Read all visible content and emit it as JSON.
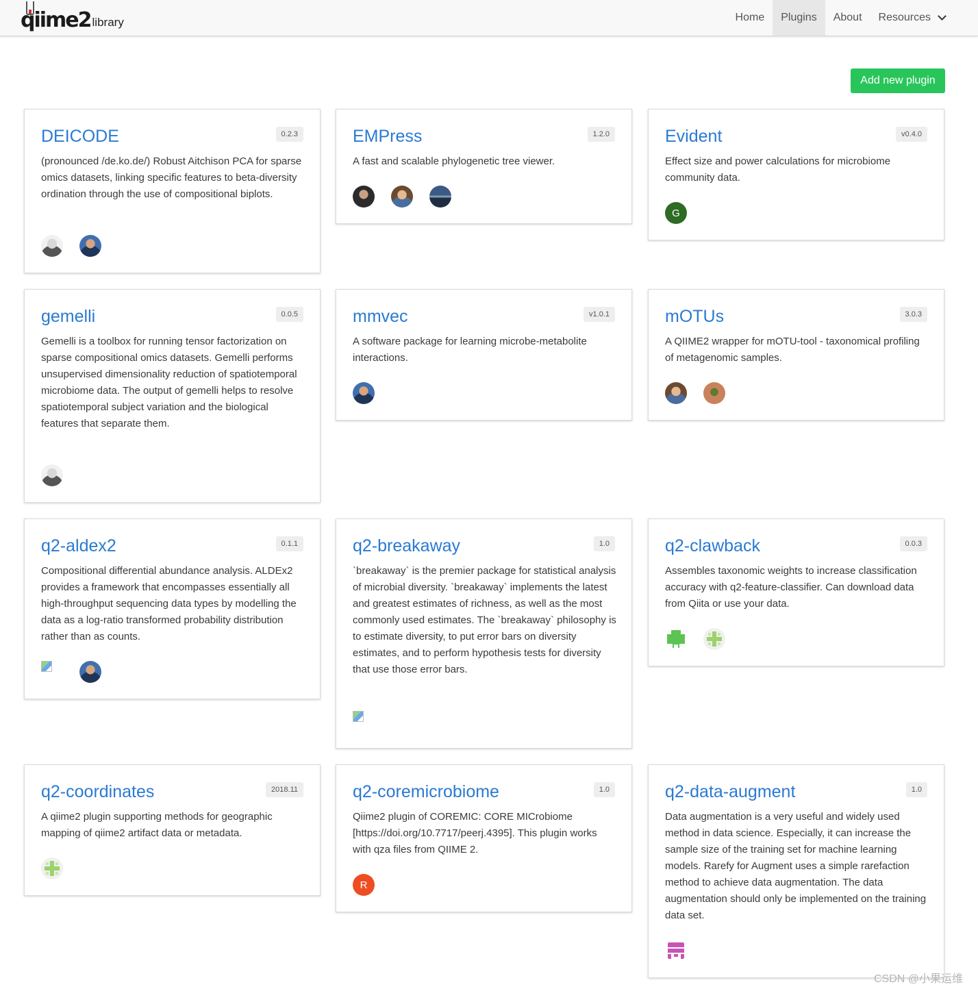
{
  "brand": {
    "logo_text": "qiime2",
    "sub_text": "library"
  },
  "nav": {
    "home": "Home",
    "plugins": "Plugins",
    "about": "About",
    "resources": "Resources"
  },
  "add_button": "Add new plugin",
  "cards": [
    {
      "title": "DEICODE",
      "version": "0.2.3",
      "description": "(pronounced /de.ko.de/) Robust Aitchison PCA for sparse omics datasets, linking specific features to beta-diversity ordination through the use of compositional biplots.",
      "avatars": [
        "avatar-photo",
        "avatar-photo"
      ]
    },
    {
      "title": "EMPress",
      "version": "1.2.0",
      "description": "A fast and scalable phylogenetic tree viewer.",
      "avatars": [
        "avatar-photo",
        "avatar-photo",
        "avatar-photo"
      ]
    },
    {
      "title": "Evident",
      "version": "v0.4.0",
      "description": "Effect size and power calculations for microbiome community data.",
      "avatars": [
        "G"
      ]
    },
    {
      "title": "gemelli",
      "version": "0.0.5",
      "description": "Gemelli is a toolbox for running tensor factorization on sparse compositional omics datasets. Gemelli performs unsupervised dimensionality reduction of spatiotemporal microbiome data. The output of gemelli helps to resolve spatiotemporal subject variation and the biological features that separate them.",
      "avatars": [
        "avatar-photo"
      ]
    },
    {
      "title": "mmvec",
      "version": "v1.0.1",
      "description": "A software package for learning microbe-metabolite interactions.",
      "avatars": [
        "avatar-photo"
      ]
    },
    {
      "title": "mOTUs",
      "version": "3.0.3",
      "description": "A QIIME2 wrapper for mOTU-tool - taxonomical profiling of metagenomic samples.",
      "avatars": [
        "avatar-photo",
        "avatar-photo"
      ]
    },
    {
      "title": "q2-aldex2",
      "version": "0.1.1",
      "description": "Compositional differential abundance analysis. ALDEx2 provides a framework that encompasses essentially all high-throughput sequencing data types by modelling the data as a log-ratio transformed probability distribution rather than as counts.",
      "avatars": [
        "broken-image",
        "avatar-photo"
      ]
    },
    {
      "title": "q2-breakaway",
      "version": "1.0",
      "description": "`breakaway` is the premier package for statistical analysis of microbial diversity. `breakaway` implements the latest and greatest estimates of richness, as well as the most commonly used estimates. The `breakaway` philosophy is to estimate diversity, to put error bars on diversity estimates, and to perform hypothesis tests for diversity that use those error bars.",
      "avatars": [
        "broken-image"
      ]
    },
    {
      "title": "q2-clawback",
      "version": "0.0.3",
      "description": "Assembles taxonomic weights to increase classification accuracy with q2-feature-classifier. Can download data from Qiita or use your data.",
      "avatars": [
        "identicon",
        "identicon"
      ]
    },
    {
      "title": "q2-coordinates",
      "version": "2018.11",
      "description": "A qiime2 plugin supporting methods for geographic mapping of qiime2 artifact data or metadata.",
      "avatars": [
        "identicon"
      ]
    },
    {
      "title": "q2-coremicrobiome",
      "version": "1.0",
      "description": "Qiime2 plugin of COREMIC: CORE MICrobiome [https://doi.org/10.7717/peerj.4395]. This plugin works with qza files from QIIME 2.",
      "avatars": [
        "R"
      ]
    },
    {
      "title": "q2-data-augment",
      "version": "1.0",
      "description": "Data augmentation is a very useful and widely used method in data science. Especially, it can increase the sample size of the training set for machine learning models. Rarefy for Augment uses a simple rarefaction method to achieve data augmentation. The data augmentation should only be implemented on the training data set.",
      "avatars": [
        "identicon"
      ]
    }
  ],
  "watermark": "CSDN @小果运维",
  "colors": {
    "accent": "#2a7ad2",
    "add_button": "#28c65a",
    "navbar_bg": "#f8f8f8"
  }
}
